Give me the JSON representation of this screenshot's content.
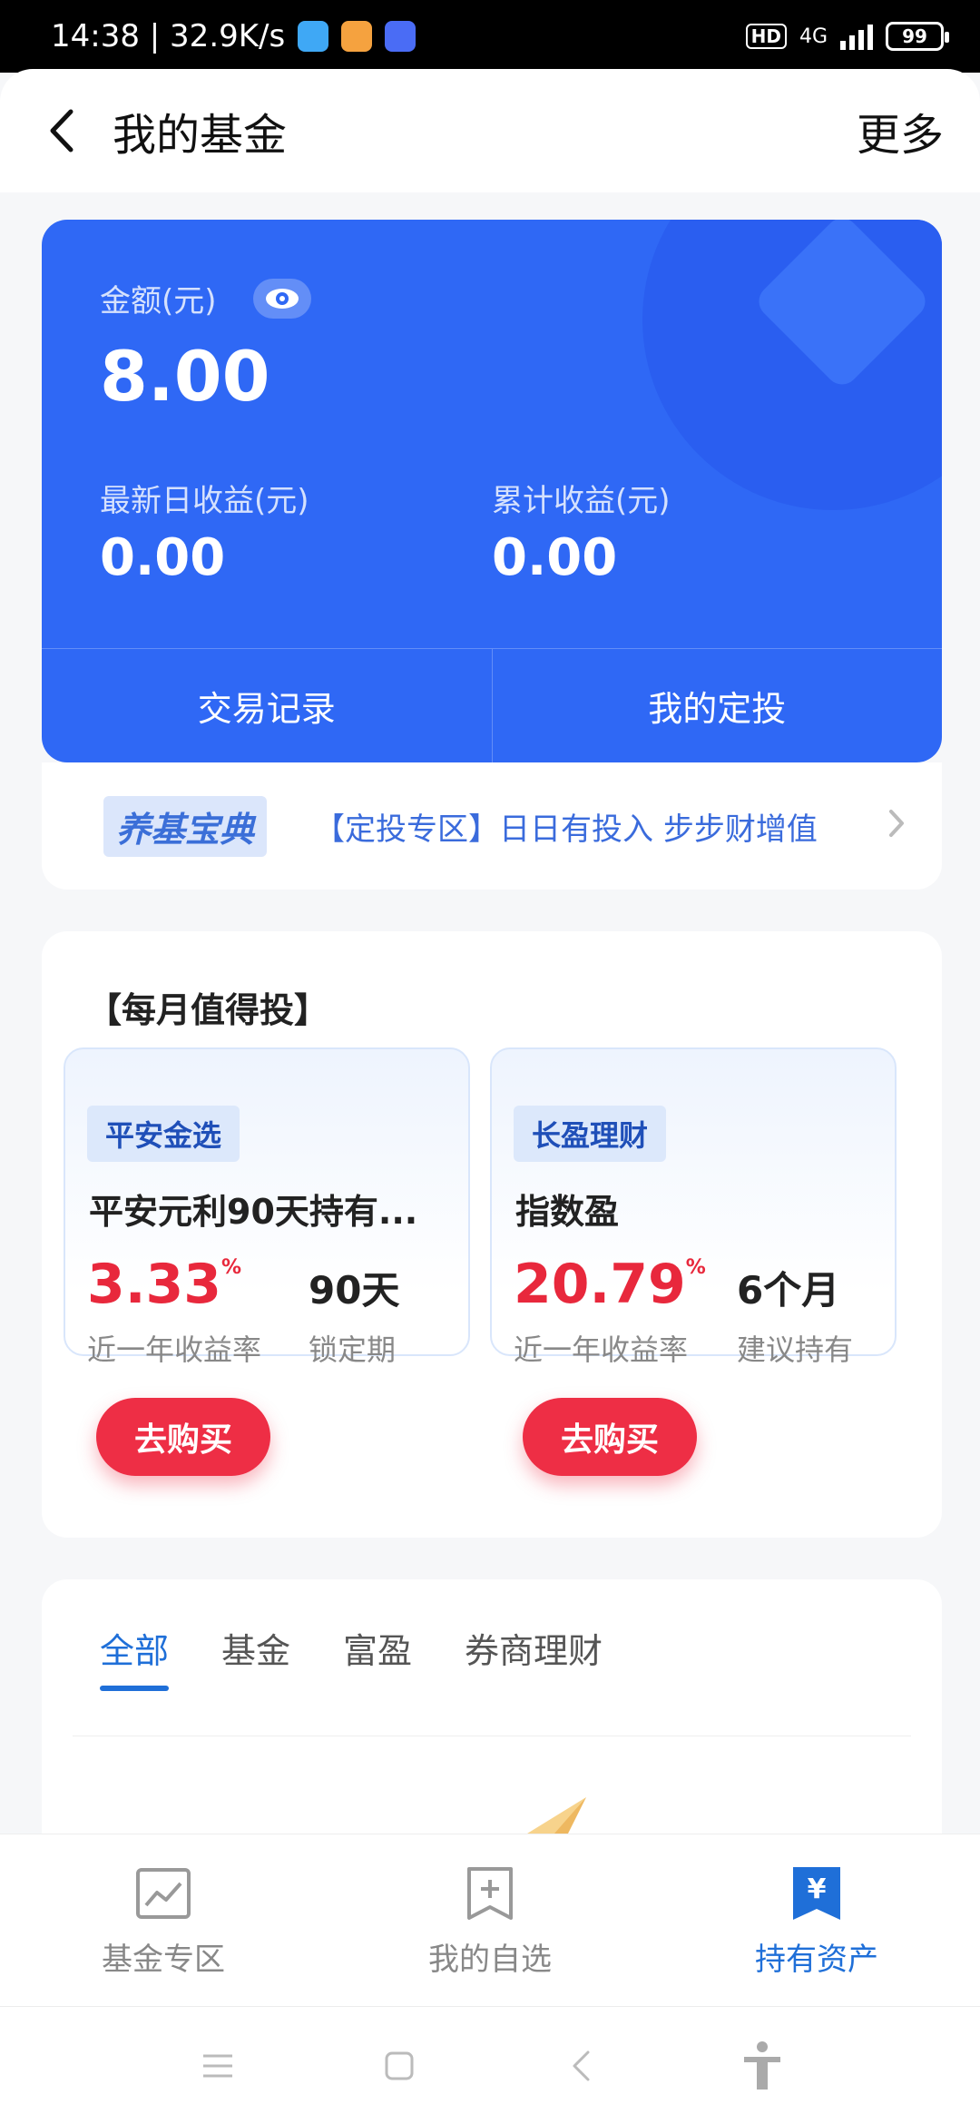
{
  "status_bar": {
    "time_speed": "14:38 | 32.9K/s",
    "network": "4G",
    "hd": "HD",
    "battery": "99"
  },
  "header": {
    "title": "我的基金",
    "more": "更多"
  },
  "asset": {
    "amount_label": "金额(元)",
    "amount_value": "8.00",
    "daily_label": "最新日收益(元)",
    "daily_value": "0.00",
    "total_label": "累计收益(元)",
    "total_value": "0.00",
    "actions": [
      "交易记录",
      "我的定投"
    ]
  },
  "promo": {
    "badge": "养基宝典",
    "text": "【定投专区】日日有投入 步步财增值"
  },
  "recommend": {
    "title": "【每月值得投】",
    "products": [
      {
        "tag": "平安金选",
        "name": "平安元利90天持有...",
        "rate": "3.33",
        "rate_unit": "%",
        "rate_label": "近一年收益率",
        "term": "90天",
        "term_label": "锁定期",
        "button": "去购买"
      },
      {
        "tag": "长盈理财",
        "name": "指数盈",
        "rate": "20.79",
        "rate_unit": "%",
        "rate_label": "近一年收益率",
        "term": "6个月",
        "term_label": "建议持有",
        "button": "去购买"
      }
    ]
  },
  "holdings": {
    "tabs": [
      "全部",
      "基金",
      "富盈",
      "券商理财"
    ],
    "active_tab": 0
  },
  "bottom_nav": {
    "items": [
      "基金专区",
      "我的自选",
      "持有资产"
    ],
    "active": 2
  },
  "colors": {
    "accent": "#2f68f5",
    "buy": "#ee2e45",
    "active_tab": "#1f6fd8"
  }
}
